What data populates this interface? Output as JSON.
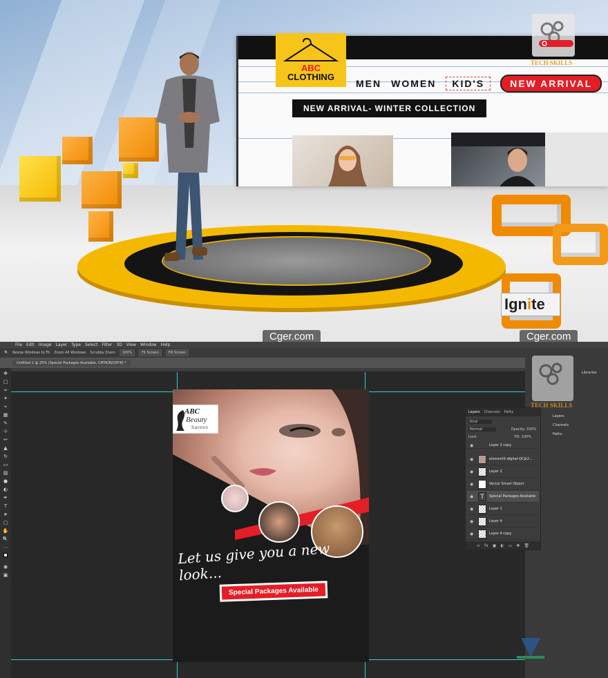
{
  "watermark": {
    "left": "Cger.com",
    "right": "Cger.com"
  },
  "studio": {
    "brand_line1": "ABC",
    "brand_line2": "CLOTHING",
    "nav": [
      "MEN",
      "WOMEN",
      "KID'S",
      "NEW ARRIVAL"
    ],
    "banner": "NEW ARRIVAL- WINTER COLLECTION",
    "ignite_pre": "Ign",
    "ignite_mid": "i",
    "ignite_post": "te",
    "tech_skills": "TECH SKILLS",
    "accent": "#f08a00",
    "yellow": "#f7c51a",
    "red": "#e41e26"
  },
  "photoshop": {
    "menus": [
      "File",
      "Edit",
      "Image",
      "Layer",
      "Type",
      "Select",
      "Filter",
      "3D",
      "View",
      "Window",
      "Help"
    ],
    "options": [
      "Resize Windows to Fit",
      "Zoom All Windows",
      "Scrubby Zoom",
      "100%",
      "Fit Screen",
      "Fill Screen"
    ],
    "doc_tab": "Untitled-1 @ 25% (Special Packages Available, CMYK/8/CMYK) *",
    "libraries": "Libraries",
    "right_strip": [
      "Layers",
      "Channels",
      "Paths"
    ],
    "layers_panel": {
      "tabs": [
        "Layers",
        "Channels",
        "Paths"
      ],
      "filter": "Kind",
      "blend_mode": "Normal",
      "opacity_label": "Opacity:",
      "opacity": "100%",
      "lock_label": "Lock:",
      "fill_label": "Fill:",
      "fill": "100%",
      "layers": [
        "Layer 2 copy",
        "element5-digital-OCJk2...",
        "Layer 2",
        "Vector Smart Object",
        "Special Packages Available",
        "Layer 1",
        "Layer 4",
        "Layer 4 copy"
      ],
      "selected": "Special Packages Available"
    }
  },
  "poster": {
    "logo_abc": "ABC",
    "logo_beauty": "Beauty",
    "logo_saloon": "Saloon",
    "tagline": "Let us give you a new look...",
    "cta": "Special Packages Available"
  }
}
